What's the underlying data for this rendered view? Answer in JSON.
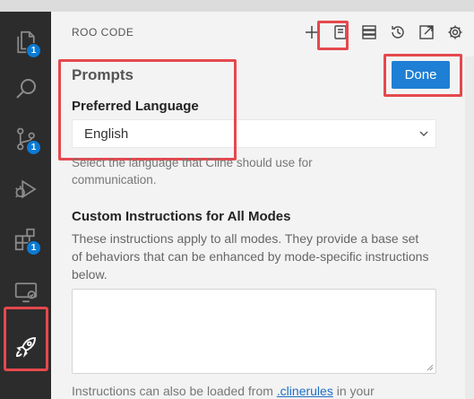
{
  "panel": {
    "title": "ROO CODE"
  },
  "activity_bar": {
    "items": [
      {
        "name": "explorer",
        "badge": "1"
      },
      {
        "name": "search",
        "badge": ""
      },
      {
        "name": "source-control",
        "badge": "1"
      },
      {
        "name": "run-debug",
        "badge": ""
      },
      {
        "name": "extensions",
        "badge": "1"
      },
      {
        "name": "remote-explorer",
        "badge": ""
      },
      {
        "name": "roo-code",
        "badge": ""
      }
    ]
  },
  "toolbar": {
    "icons": [
      "plus-icon",
      "prompts-icon",
      "mcp-servers-icon",
      "history-icon",
      "popout-icon",
      "settings-icon"
    ]
  },
  "prompts": {
    "title": "Prompts",
    "done_label": "Done",
    "preferred_language": {
      "label": "Preferred Language",
      "value": "English",
      "help": "Select the language that Cline should use for communication."
    },
    "custom_instructions": {
      "label": "Custom Instructions for All Modes",
      "description": "These instructions apply to all modes. They provide a base set of behaviors that can be enhanced by mode-specific instructions below.",
      "value": "",
      "footer_prefix": "Instructions can also be loaded from ",
      "footer_link": ".clinerules",
      "footer_suffix": " in your"
    }
  },
  "colors": {
    "accent": "#1e7fd4",
    "highlight": "#e5484d",
    "activity_bg": "#2c2c2c",
    "badge": "#0a7bd5"
  }
}
